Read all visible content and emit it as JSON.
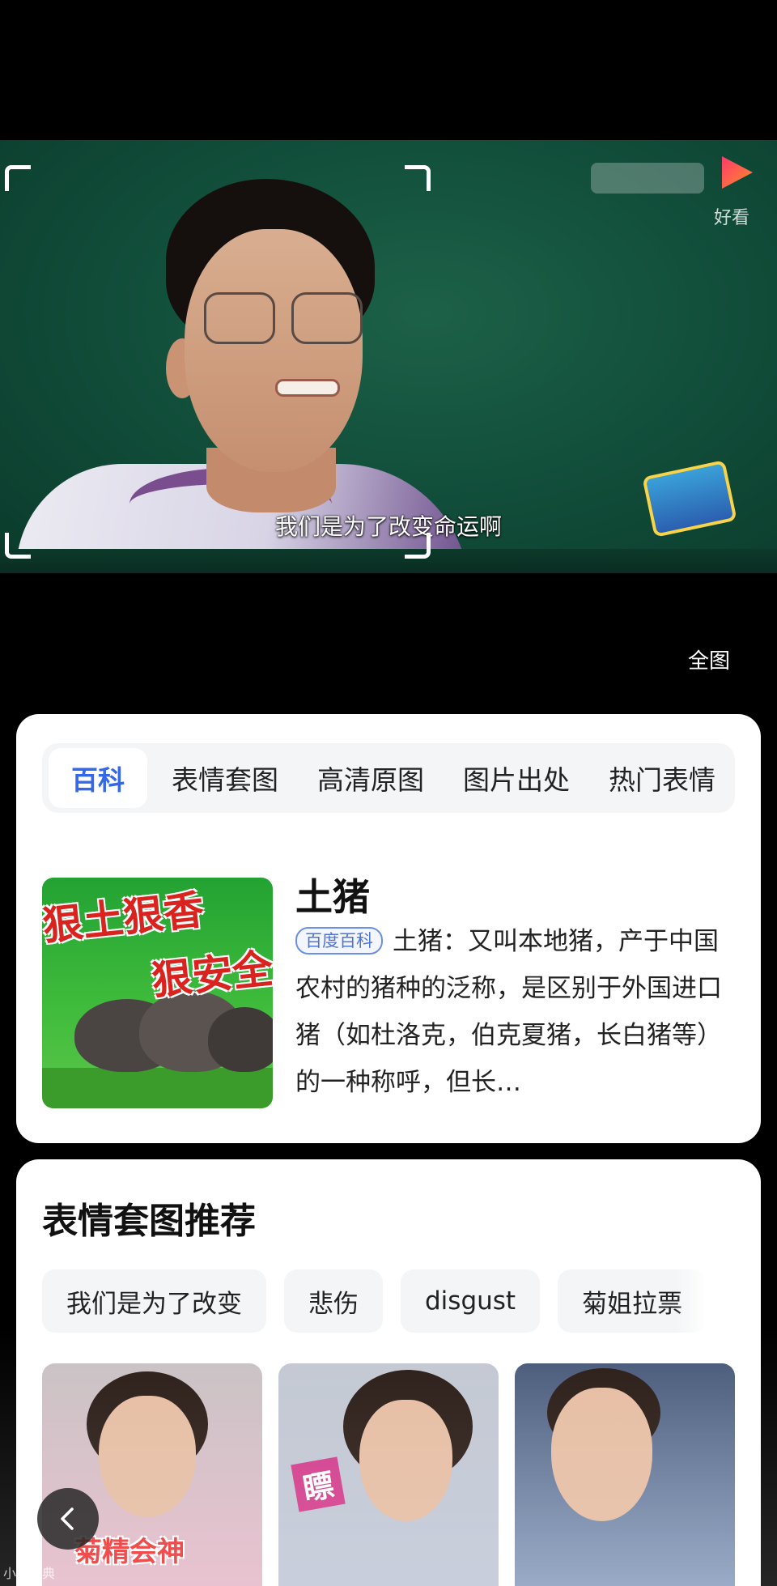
{
  "photo": {
    "subtitle": "我们是为了改变命运啊",
    "watermark": "好看"
  },
  "full_image_label": "全图",
  "tabs": [
    {
      "label": "百科",
      "active": true
    },
    {
      "label": "表情套图",
      "active": false
    },
    {
      "label": "高清原图",
      "active": false
    },
    {
      "label": "图片出处",
      "active": false
    },
    {
      "label": "热门表情",
      "active": false
    }
  ],
  "baike": {
    "thumb_text_1": "狠土狠香",
    "thumb_text_2": "狠安全",
    "title": "土猪",
    "badge": "百度百科",
    "description": "土猪：又叫本地猪，产于中国农村的猪种的泛称，是区别于外国进口猪（如杜洛克，伯克夏猪，长白猪等）的一种称呼，但长…"
  },
  "sets": {
    "title": "表情套图推荐",
    "chips": [
      "我们是为了改变",
      "悲伤",
      "disgust",
      "菊姐拉票"
    ],
    "tiles": [
      {
        "caption": "菊精会神"
      },
      {
        "caption": "瞟"
      },
      {
        "caption": ""
      }
    ]
  },
  "bottom_mark": "小猪词典",
  "colors": {
    "accent": "#3568e8",
    "badge_border": "#6b8fe6",
    "chip_bg": "#f4f5f7",
    "page_bg": "#000000"
  }
}
